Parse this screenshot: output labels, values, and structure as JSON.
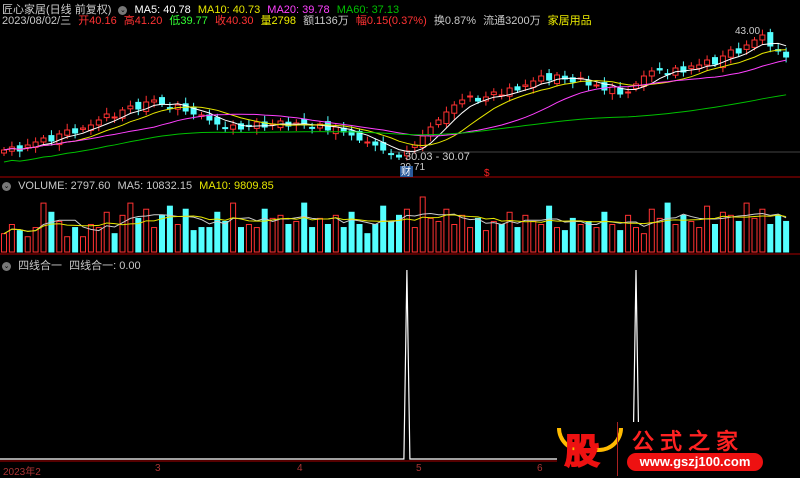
{
  "header": {
    "name": "匠心家居(日线 前复权)",
    "ma5": "MA5: 40.78",
    "ma10": "MA10: 40.73",
    "ma20": "MA20: 39.78",
    "ma60": "MA60: 37.13",
    "date": "2023/08/02/三",
    "open": "开40.16",
    "high": "高41.20",
    "low": "低39.77",
    "close": "收40.30",
    "vol": "量2798",
    "amount": "额1136万",
    "change": "幅0.15(0.37%)",
    "turnover": "换0.87%",
    "float": "流通3200万",
    "sector": "家居用品"
  },
  "volume_label": {
    "vol": "VOLUME: 2797.60",
    "ma5": "MA5: 10832.15",
    "ma10": "MA10: 9809.85"
  },
  "signal_label": {
    "name": "四线合一",
    "value": "四线合一: 0.00"
  },
  "annotations": {
    "high": "43.00",
    "low": "29.71",
    "range": "30.03 - 30.07",
    "badge": "财",
    "mark": "$"
  },
  "axis": [
    "2023年2",
    "3",
    "4",
    "5",
    "6"
  ],
  "logo": {
    "char": "股",
    "title": "公式之家",
    "url": "www.gszj100.com"
  },
  "colors": {
    "up": "#ff3232",
    "down": "#54ffff",
    "ma5": "#ffffff",
    "ma10": "#e6e600",
    "ma20": "#ff40ff",
    "ma60": "#00c000"
  },
  "chart_data": {
    "type": "candlestick",
    "title": "匠心家居(日线 前复权)",
    "close": [
      31.0,
      31.3,
      30.9,
      31.5,
      31.8,
      32.2,
      31.9,
      32.6,
      33.0,
      32.7,
      33.2,
      33.5,
      34.0,
      34.6,
      34.3,
      35.0,
      35.4,
      35.1,
      35.8,
      36.0,
      35.6,
      35.2,
      35.5,
      34.9,
      34.6,
      34.5,
      34.0,
      33.6,
      33.2,
      33.5,
      33.1,
      33.4,
      33.8,
      33.3,
      33.6,
      33.9,
      33.4,
      33.7,
      33.5,
      33.2,
      33.6,
      33.0,
      33.3,
      32.8,
      32.5,
      32.0,
      31.8,
      31.5,
      31.0,
      30.6,
      30.3,
      30.9,
      31.5,
      32.4,
      33.3,
      34.0,
      34.8,
      35.5,
      36.0,
      36.4,
      35.9,
      36.3,
      36.8,
      36.5,
      37.2,
      37.0,
      37.5,
      37.9,
      38.4,
      38.0,
      38.5,
      38.1,
      37.8,
      38.2,
      37.5,
      37.5,
      37.0,
      37.3,
      36.6,
      36.8,
      37.6,
      38.4,
      38.9,
      39.0,
      38.6,
      39.2,
      38.8,
      39.4,
      39.5,
      40.0,
      39.6,
      40.4,
      41.0,
      40.7,
      41.5,
      42.0,
      42.5,
      41.4,
      40.9,
      40.3
    ],
    "volume": [
      6,
      9,
      7,
      5,
      8,
      16,
      13,
      10,
      5,
      8,
      5,
      9,
      8,
      13,
      6,
      12,
      16,
      11,
      14,
      8,
      12,
      15,
      9,
      14,
      7,
      8,
      8,
      13,
      10,
      16,
      8,
      9,
      8,
      14,
      11,
      12,
      9,
      10,
      16,
      8,
      11,
      9,
      12,
      8,
      13,
      9,
      6,
      9,
      15,
      10,
      12,
      14,
      8,
      18,
      11,
      10,
      14,
      9,
      12,
      8,
      11,
      7,
      10,
      9,
      13,
      8,
      12,
      10,
      9,
      15,
      8,
      7,
      11,
      9,
      10,
      8,
      13,
      9,
      7,
      12,
      8,
      6,
      14,
      11,
      16,
      9,
      12,
      10,
      8,
      15,
      9,
      13,
      12,
      10,
      16,
      11,
      14,
      9,
      12,
      10
    ],
    "signal_spikes": [
      51,
      80
    ],
    "ylim": [
      28.5,
      44
    ]
  }
}
